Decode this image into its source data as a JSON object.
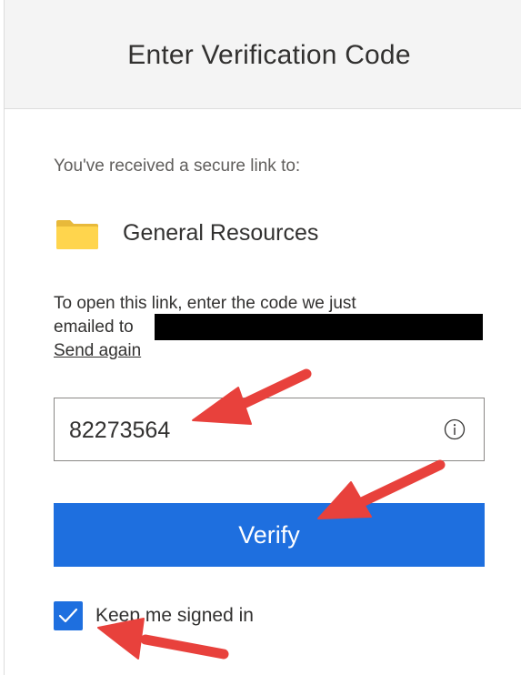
{
  "header": {
    "title": "Enter Verification Code"
  },
  "content": {
    "received_text": "You've received a secure link to:",
    "resource_name": "General Resources",
    "instructions_line1": "To open this link, enter the code we just",
    "instructions_line2": "emailed to",
    "send_again_label": "Send again"
  },
  "code_field": {
    "value": "82273564",
    "info_icon": "info-icon"
  },
  "verify_button": {
    "label": "Verify"
  },
  "keep_signed_in": {
    "label": "Keep me signed in",
    "checked": true
  },
  "icons": {
    "folder": "folder-icon",
    "checkmark": "checkmark-icon",
    "info": "info-icon"
  },
  "colors": {
    "accent": "#1e6fdf",
    "header_bg": "#f4f4f4",
    "folder": "#ffd54d",
    "annotation_arrow": "#e8413c",
    "redaction": "#000000"
  }
}
